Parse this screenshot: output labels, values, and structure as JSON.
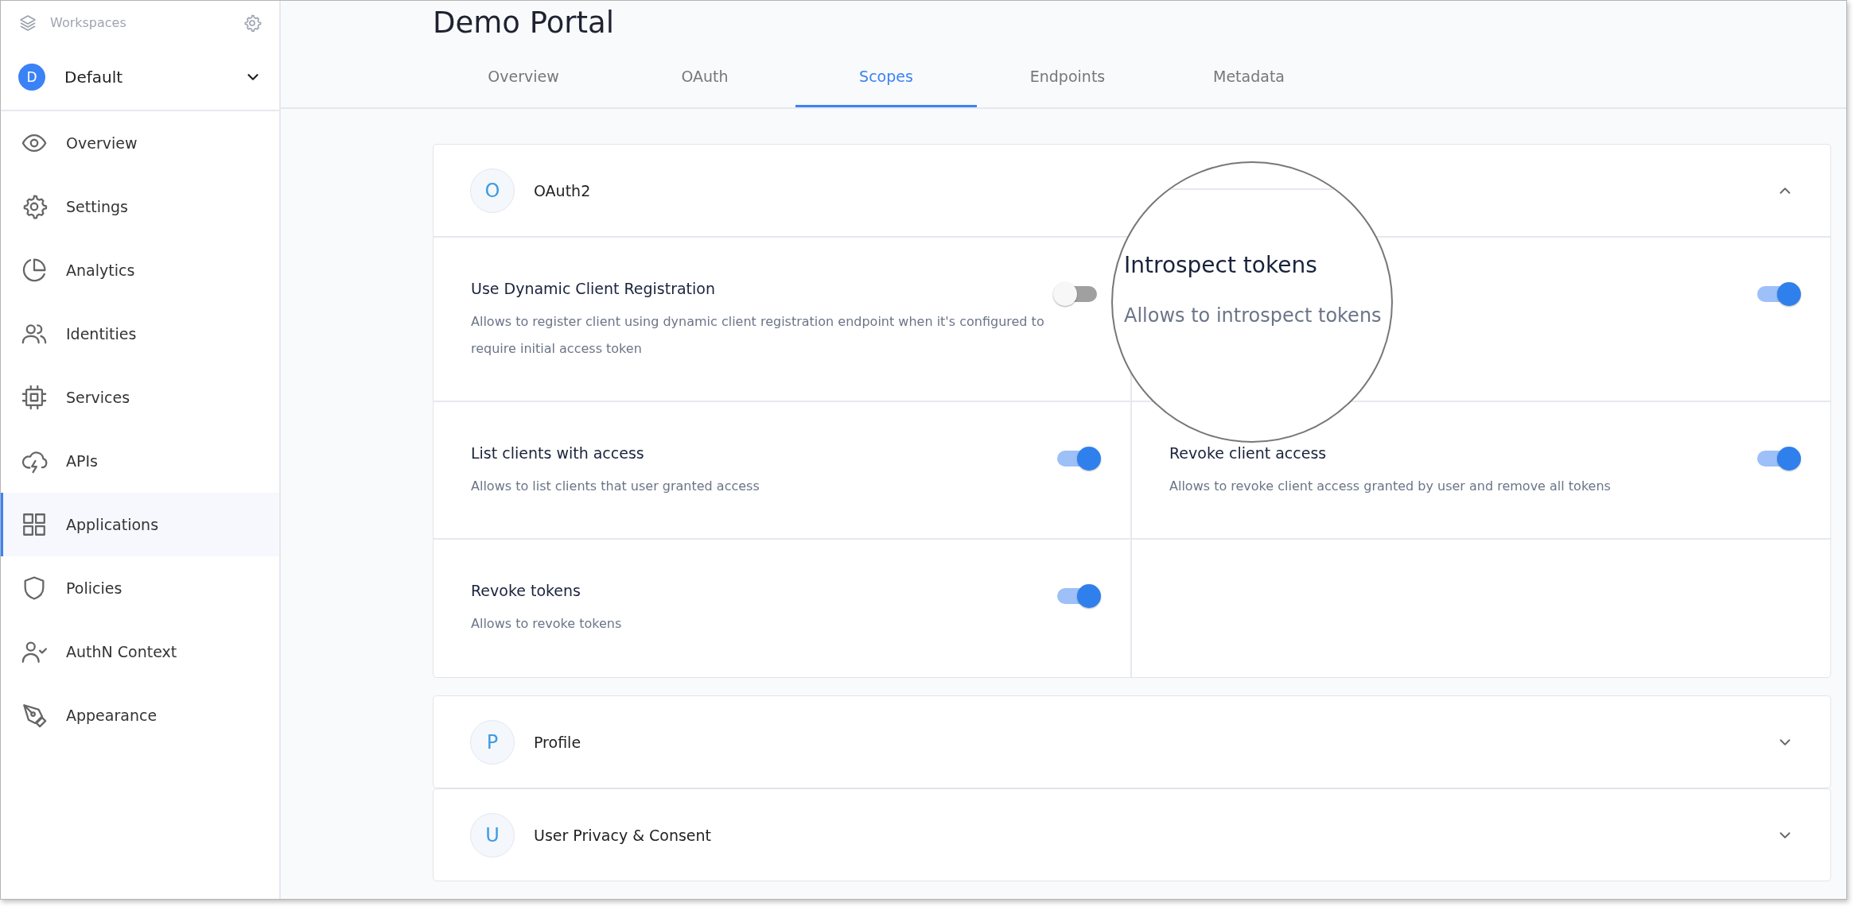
{
  "sidebar": {
    "workspaces_label": "Workspaces",
    "workspace": {
      "initial": "D",
      "name": "Default"
    },
    "items": [
      {
        "label": "Overview",
        "selected": false
      },
      {
        "label": "Settings",
        "selected": false
      },
      {
        "label": "Analytics",
        "selected": false
      },
      {
        "label": "Identities",
        "selected": false
      },
      {
        "label": "Services",
        "selected": false
      },
      {
        "label": "APIs",
        "selected": false
      },
      {
        "label": "Applications",
        "selected": true
      },
      {
        "label": "Policies",
        "selected": false
      },
      {
        "label": "AuthN Context",
        "selected": false
      },
      {
        "label": "Appearance",
        "selected": false
      }
    ]
  },
  "page": {
    "title": "Demo Portal"
  },
  "tabs": [
    {
      "label": "Overview",
      "selected": false
    },
    {
      "label": "OAuth",
      "selected": false
    },
    {
      "label": "Scopes",
      "selected": true
    },
    {
      "label": "Endpoints",
      "selected": false
    },
    {
      "label": "Metadata",
      "selected": false
    }
  ],
  "sections": [
    {
      "initial": "O",
      "title": "OAuth2",
      "expanded": true,
      "scopes": [
        {
          "title": "Use Dynamic Client Registration",
          "description": "Allows to register client using dynamic client registration endpoint when it's configured to require initial access token",
          "on": false
        },
        {
          "on": true
        },
        {
          "title": "List clients with access",
          "description": "Allows to list clients that user granted access",
          "on": true
        },
        {
          "title": "Revoke client access",
          "description": "Allows to revoke client access granted by user and remove all tokens",
          "on": true
        },
        {
          "title": "Revoke tokens",
          "description": "Allows to revoke tokens",
          "on": true
        }
      ]
    },
    {
      "initial": "P",
      "title": "Profile",
      "expanded": false
    },
    {
      "initial": "U",
      "title": "User Privacy & Consent",
      "expanded": false
    }
  ],
  "magnifier": {
    "title": "Introspect tokens",
    "description": "Allows to introspect tokens"
  }
}
